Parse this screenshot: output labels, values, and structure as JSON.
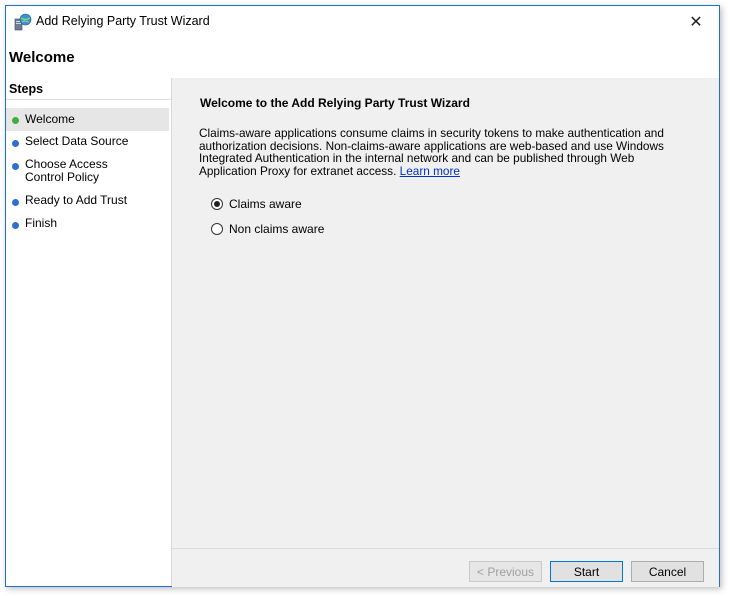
{
  "window": {
    "title": "Add Relying Party Trust Wizard",
    "close_label": "✕"
  },
  "header": {
    "title": "Welcome"
  },
  "steps": {
    "title": "Steps",
    "items": [
      {
        "label": "Welcome",
        "status": "current",
        "dot_color": "#3fae3f"
      },
      {
        "label": "Select Data Source",
        "status": "pending",
        "dot_color": "#2f6ed2"
      },
      {
        "label": "Choose Access Control Policy",
        "status": "pending",
        "dot_color": "#2f6ed2"
      },
      {
        "label": "Ready to Add Trust",
        "status": "pending",
        "dot_color": "#2f6ed2"
      },
      {
        "label": "Finish",
        "status": "pending",
        "dot_color": "#2f6ed2"
      }
    ]
  },
  "content": {
    "title": "Welcome to the Add Relying Party Trust Wizard",
    "description": "Claims-aware applications consume claims in security tokens to make authentication and authorization decisions. Non-claims-aware applications are web-based and use Windows Integrated Authentication in the internal network and can be published through Web Application Proxy for extranet access.",
    "learn_more": "Learn more",
    "options": [
      {
        "label": "Claims aware",
        "checked": true
      },
      {
        "label": "Non claims aware",
        "checked": false
      }
    ]
  },
  "footer": {
    "previous": "< Previous",
    "start": "Start",
    "cancel": "Cancel"
  },
  "colors": {
    "window_border": "#1e6fd6",
    "link": "#0033cc",
    "step_current": "#3fae3f",
    "step_pending": "#2f6ed2"
  },
  "icons": {
    "app": "server-globe-icon",
    "close": "close-icon"
  }
}
